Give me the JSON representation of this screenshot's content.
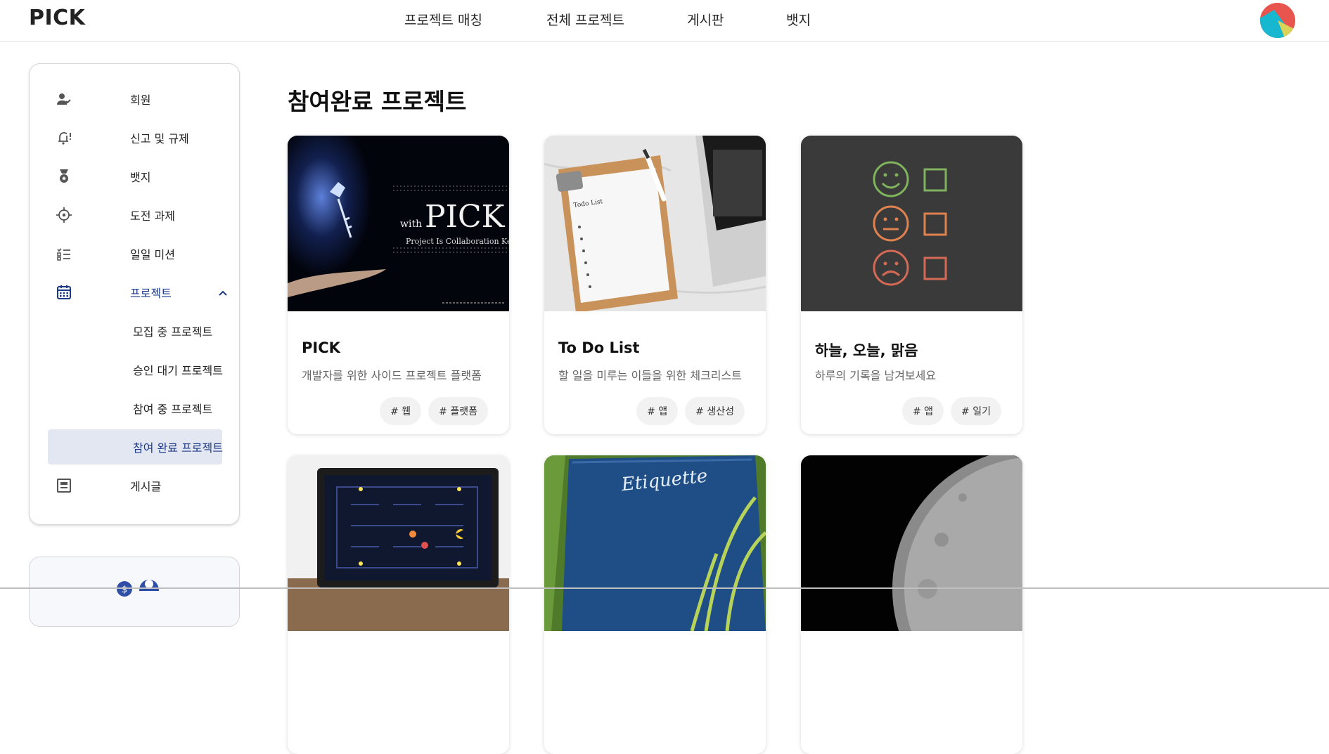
{
  "header": {
    "logo": "PICK",
    "nav": [
      "프로젝트 매칭",
      "전체 프로젝트",
      "게시판",
      "뱃지"
    ]
  },
  "sidebar": {
    "items": [
      {
        "label": "회원",
        "icon": "user-check-icon"
      },
      {
        "label": "신고 및 규제",
        "icon": "bell-alert-icon"
      },
      {
        "label": "뱃지",
        "icon": "medal-icon"
      },
      {
        "label": "도전 과제",
        "icon": "crosshair-icon"
      },
      {
        "label": "일일 미션",
        "icon": "checklist-icon"
      },
      {
        "label": "프로젝트",
        "icon": "calendar-icon"
      },
      {
        "label": "게시글",
        "icon": "document-icon"
      }
    ],
    "project_sub": [
      "모집 중 프로젝트",
      "승인 대기 프로젝트",
      "참여 중 프로젝트",
      "참여 완료 프로젝트"
    ],
    "selected_sub": "참여 완료 프로젝트"
  },
  "main": {
    "title": "참여완료 프로젝트",
    "cards": [
      {
        "title": "PICK",
        "desc": "개발자를 위한 사이드 프로젝트 플랫폼",
        "tags": [
          "# 웹",
          "# 플랫폼"
        ],
        "image_text": {
          "with": "with",
          "pick": "PICK",
          "sub": "Project Is Collaboration Key"
        }
      },
      {
        "title": "To Do List",
        "desc": "할 일을 미루는 이들을 위한 체크리스트",
        "tags": [
          "# 앱",
          "# 생산성"
        ],
        "image_text": {
          "todo": "Todo List"
        }
      },
      {
        "title": "하늘, 오늘, 맑음",
        "desc": "하루의 기록을 남겨보세요",
        "tags": [
          "# 앱",
          "# 일기"
        ]
      }
    ],
    "row2_image_text": {
      "etiquette": "Etiquette"
    }
  },
  "colors": {
    "accent": "#1d3a8a",
    "selected_bg": "#e3e7f2"
  }
}
